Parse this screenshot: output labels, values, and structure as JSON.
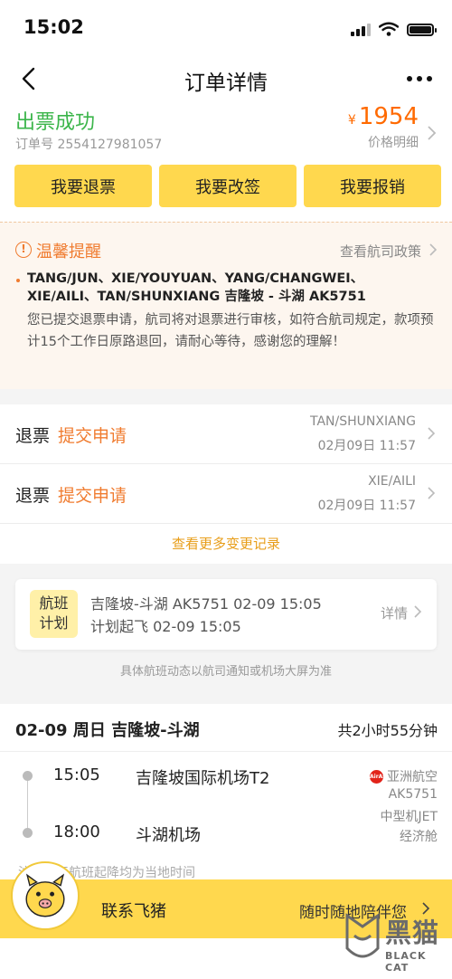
{
  "status_bar": {
    "time": "15:02"
  },
  "nav": {
    "title": "订单详情"
  },
  "order": {
    "status": "出票成功",
    "order_no": "订单号 2554127981057",
    "currency": "¥",
    "price": "1954",
    "price_detail": "价格明细"
  },
  "actions": [
    "我要退票",
    "我要改签",
    "我要报销"
  ],
  "notice": {
    "title": "温馨提醒",
    "link": "查看航司政策",
    "passengers": "TANG/JUN、XIE/YOUYUAN、YANG/CHANGWEI、XIE/AILI、TAN/SHUNXIANG 吉隆坡 - 斗湖 AK5751",
    "body": "您已提交退票申请，航司将对退票进行审核，如符合航司规定，款项预计15个工作日原路退回，请耐心等待，感谢您的理解！"
  },
  "refunds": [
    {
      "type": "退票",
      "status": "提交申请",
      "name": "TAN/SHUNXIANG",
      "time": "02月09日 11:57"
    },
    {
      "type": "退票",
      "status": "提交申请",
      "name": "XIE/AILI",
      "time": "02月09日 11:57"
    }
  ],
  "more_records": "查看更多变更记录",
  "flight_plan": {
    "badge_line1": "航班",
    "badge_line2": "计划",
    "line1": "吉隆坡-斗湖 AK5751 02-09 15:05",
    "line2": "计划起飞 02-09 15:05",
    "detail": "详情",
    "note": "具体航班动态以航司通知或机场大屏为准"
  },
  "trip": {
    "header": "02-09 周日 吉隆坡-斗湖",
    "duration": "共2小时55分钟",
    "departure": {
      "time": "15:05",
      "airport": "吉隆坡国际机场T2"
    },
    "arrival": {
      "time": "18:00",
      "airport": "斗湖机场"
    },
    "airline": "亚洲航空",
    "airline_logo_text": "AirAsia",
    "flight_no": "AK5751",
    "aircraft": "中型机JET",
    "cabin": "经济舱",
    "note": "注：国际航班起降均为当地时间"
  },
  "contact": {
    "label": "联系飞猪",
    "sub": "随时随地陪伴您"
  },
  "watermark": {
    "cn": "黑猫",
    "en": "BLACK CAT"
  },
  "colors": {
    "accent_yellow": "#ffd84e",
    "success_green": "#3bb54a",
    "price_orange": "#ff6a00",
    "notice_orange": "#f07c30"
  }
}
